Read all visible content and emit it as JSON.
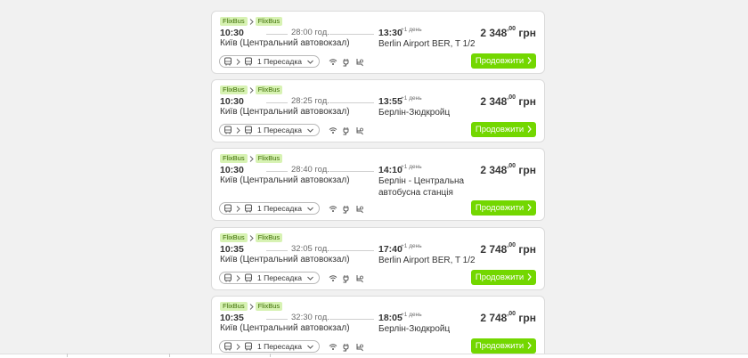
{
  "results": [
    {
      "brands": [
        "FlixBus",
        "FlixBus"
      ],
      "departure_time": "10:30",
      "departure_stop": "Київ (Центральний автовокзал)",
      "duration": "28:00 год.",
      "arrival_time": "13:30",
      "plus_day": "+1 день",
      "arrival_stop": "Berlin Airport BER, T 1/2",
      "price_main": "2 348",
      "price_cents": ",00",
      "currency": "грн",
      "transfers": "1 Пересадка",
      "button": "Продовжити"
    },
    {
      "brands": [
        "FlixBus",
        "FlixBus"
      ],
      "departure_time": "10:30",
      "departure_stop": "Київ (Центральний автовокзал)",
      "duration": "28:25 год.",
      "arrival_time": "13:55",
      "plus_day": "+1 день",
      "arrival_stop": "Берлін-Зюдкройц",
      "price_main": "2 348",
      "price_cents": ",00",
      "currency": "грн",
      "transfers": "1 Пересадка",
      "button": "Продовжити"
    },
    {
      "brands": [
        "FlixBus",
        "FlixBus"
      ],
      "departure_time": "10:30",
      "departure_stop": "Київ (Центральний автовокзал)",
      "duration": "28:40 год.",
      "arrival_time": "14:10",
      "plus_day": "+1 день",
      "arrival_stop": "Берлін - Центральна автобусна станція",
      "price_main": "2 348",
      "price_cents": ",00",
      "currency": "грн",
      "transfers": "1 Пересадка",
      "button": "Продовжити"
    },
    {
      "brands": [
        "FlixBus",
        "FlixBus"
      ],
      "departure_time": "10:35",
      "departure_stop": "Київ (Центральний автовокзал)",
      "duration": "32:05 год.",
      "arrival_time": "17:40",
      "plus_day": "+1 день",
      "arrival_stop": "Berlin Airport BER, T 1/2",
      "price_main": "2 748",
      "price_cents": ",00",
      "currency": "грн",
      "transfers": "1 Пересадка",
      "button": "Продовжити"
    },
    {
      "brands": [
        "FlixBus",
        "FlixBus"
      ],
      "departure_time": "10:35",
      "departure_stop": "Київ (Центральний автовокзал)",
      "duration": "32:30 год.",
      "arrival_time": "18:05",
      "plus_day": "+1 день",
      "arrival_stop": "Берлін-Зюдкройц",
      "price_main": "2 748",
      "price_cents": ",00",
      "currency": "грн",
      "transfers": "1 Пересадка",
      "button": "Продовжити"
    }
  ],
  "icons": {
    "bus": "bus-icon",
    "chevron_right": "chevron-right-icon",
    "chevron_down": "chevron-down-icon",
    "wifi": "wifi-icon",
    "socket": "power-socket-icon",
    "seat": "seat-icon"
  },
  "colors": {
    "accent": "#73d700",
    "badge_bg": "#d7f2b3",
    "badge_text": "#3a6b00"
  }
}
